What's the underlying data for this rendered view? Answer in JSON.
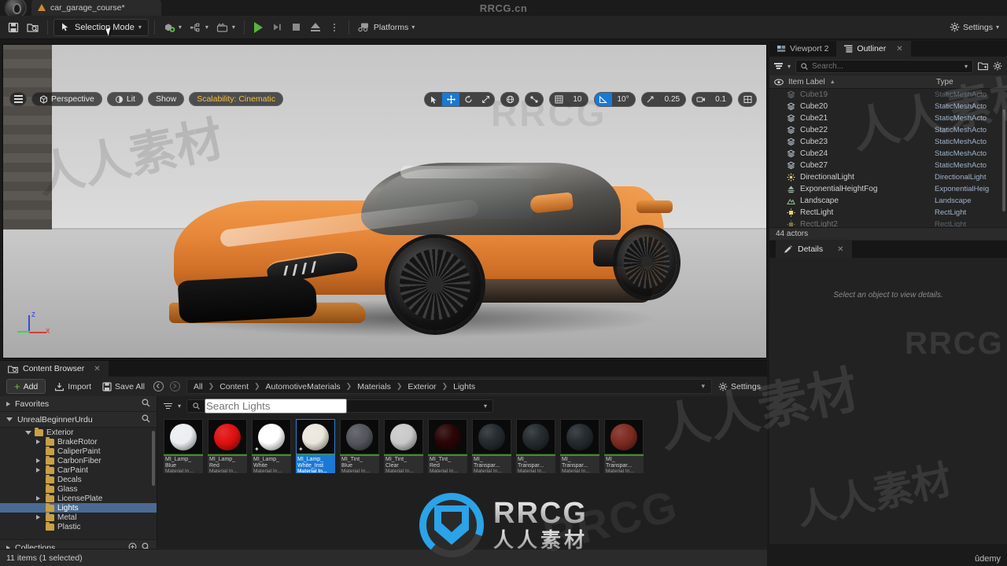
{
  "titlebar": {
    "project_tab": "car_garage_course*",
    "brand_watermark": "RRCG.cn"
  },
  "toolbar": {
    "save_label": "Save",
    "save_all_icon": "save-icon",
    "browse_icon": "browse-content-icon",
    "selection_mode": "Selection Mode",
    "quick_add": "quick-add-icon",
    "blueprints": "blueprints-icon",
    "cinematics": "cinematics-icon",
    "play": "play-icon",
    "skip": "skip-icon",
    "stop": "stop-icon",
    "eject": "eject-icon",
    "more": "more-options-icon",
    "platforms": "Platforms",
    "settings": "Settings"
  },
  "viewport": {
    "menu_icon": "viewport-menu-icon",
    "perspective": "Perspective",
    "lit": "Lit",
    "show": "Show",
    "scalability": "Scalability: Cinematic",
    "tools": {
      "select": "select-tool-icon",
      "translate": "translate-tool-icon",
      "rotate": "rotate-tool-icon",
      "scale": "scale-tool-icon",
      "world_coords": "world-coordinates-icon",
      "surface_snap": "surface-snap-icon",
      "grid_snap_icon": "grid-snap-icon",
      "grid_snap_value": "10",
      "angle_snap_icon": "angle-snap-icon",
      "angle_snap_value": "10°",
      "scale_snap_icon": "scale-snap-icon",
      "scale_snap_value": "0.25",
      "camera_speed_icon": "camera-speed-icon",
      "camera_speed_value": "0.1",
      "maximize_icon": "maximize-viewport-icon"
    },
    "axis": {
      "z": "Z",
      "x": "X"
    }
  },
  "outliner": {
    "tab_viewport": "Viewport 2",
    "tab_outliner": "Outliner",
    "search_placeholder": "Search...",
    "search_value": "",
    "col_item_label": "Item Label",
    "col_type": "Type",
    "sort_indicator": "▲",
    "rows": [
      {
        "name": "Cube19",
        "type": "StaticMeshActo",
        "icon": "static-mesh-icon"
      },
      {
        "name": "Cube20",
        "type": "StaticMeshActo",
        "icon": "static-mesh-icon"
      },
      {
        "name": "Cube21",
        "type": "StaticMeshActo",
        "icon": "static-mesh-icon"
      },
      {
        "name": "Cube22",
        "type": "StaticMeshActo",
        "icon": "static-mesh-icon"
      },
      {
        "name": "Cube23",
        "type": "StaticMeshActo",
        "icon": "static-mesh-icon"
      },
      {
        "name": "Cube24",
        "type": "StaticMeshActo",
        "icon": "static-mesh-icon"
      },
      {
        "name": "Cube27",
        "type": "StaticMeshActo",
        "icon": "static-mesh-icon"
      },
      {
        "name": "DirectionalLight",
        "type": "DirectionalLight",
        "icon": "directional-light-icon"
      },
      {
        "name": "ExponentialHeightFog",
        "type": "ExponentialHeig",
        "icon": "fog-icon"
      },
      {
        "name": "Landscape",
        "type": "Landscape",
        "icon": "landscape-icon"
      },
      {
        "name": "RectLight",
        "type": "RectLight",
        "icon": "rect-light-icon"
      },
      {
        "name": "RectLight2",
        "type": "RectLight",
        "icon": "rect-light-icon"
      }
    ],
    "footer": "44 actors"
  },
  "details": {
    "tab_label": "Details",
    "empty_message": "Select an object to view details."
  },
  "content_browser": {
    "tab_label": "Content Browser",
    "add_label": "Add",
    "import_label": "Import",
    "save_all_label": "Save All",
    "back_icon": "nav-back-icon",
    "forward_icon": "nav-forward-icon",
    "breadcrumbs": [
      "All",
      "Content",
      "AutomotiveMaterials",
      "Materials",
      "Exterior",
      "Lights"
    ],
    "settings_label": "Settings",
    "favorites_label": "Favorites",
    "project_root_label": "UnrealBeginnerUrdu",
    "collections_label": "Collections",
    "tree": [
      {
        "label": "Exterior",
        "depth": 1,
        "expanded": true,
        "selected": false,
        "has_children": true
      },
      {
        "label": "BrakeRotor",
        "depth": 2,
        "expanded": false,
        "selected": false,
        "has_children": true
      },
      {
        "label": "CaliperPaint",
        "depth": 2,
        "expanded": false,
        "selected": false,
        "has_children": false
      },
      {
        "label": "CarbonFiber",
        "depth": 2,
        "expanded": false,
        "selected": false,
        "has_children": true
      },
      {
        "label": "CarPaint",
        "depth": 2,
        "expanded": false,
        "selected": false,
        "has_children": true
      },
      {
        "label": "Decals",
        "depth": 2,
        "expanded": false,
        "selected": false,
        "has_children": false
      },
      {
        "label": "Glass",
        "depth": 2,
        "expanded": false,
        "selected": false,
        "has_children": false
      },
      {
        "label": "LicensePlate",
        "depth": 2,
        "expanded": false,
        "selected": false,
        "has_children": true
      },
      {
        "label": "Lights",
        "depth": 2,
        "expanded": false,
        "selected": true,
        "has_children": false
      },
      {
        "label": "Metal",
        "depth": 2,
        "expanded": false,
        "selected": false,
        "has_children": true
      },
      {
        "label": "Plastic",
        "depth": 2,
        "expanded": false,
        "selected": false,
        "has_children": false
      }
    ],
    "asset_search_placeholder": "Search Lights",
    "assets": [
      {
        "name": "MI_Lamp_",
        "name2": "Blue",
        "type": "Material In...",
        "color": "#eceff2",
        "selected": false,
        "starred": false
      },
      {
        "name": "MI_Lamp_",
        "name2": "Red",
        "type": "Material In...",
        "color": "#e01111",
        "selected": false,
        "starred": false
      },
      {
        "name": "MI_Lamp_",
        "name2": "White",
        "type": "Material In...",
        "color": "#ffffff",
        "selected": false,
        "starred": true
      },
      {
        "name": "MI_Lamp_",
        "name2": "White_Inst",
        "type": "Material In...",
        "color": "#ece7dd",
        "selected": true,
        "starred": true
      },
      {
        "name": "MI_Tint_",
        "name2": "Blue",
        "type": "Material In...",
        "color": "#53565c",
        "selected": false,
        "starred": false
      },
      {
        "name": "MI_Tint_",
        "name2": "Clear",
        "type": "Material In...",
        "color": "#c9c9c9",
        "selected": false,
        "starred": false
      },
      {
        "name": "MI_Tint_",
        "name2": "Red",
        "type": "Material In...",
        "color": "#2a0506",
        "selected": false,
        "starred": false
      },
      {
        "name": "MI_",
        "name2": "Transpar...",
        "type": "Material In...",
        "color": "#242a2e",
        "selected": false,
        "starred": false
      },
      {
        "name": "MI_",
        "name2": "Transpar...",
        "type": "Material In...",
        "color": "#242a2e",
        "selected": false,
        "starred": false
      },
      {
        "name": "MI_",
        "name2": "Transpar...",
        "type": "Material In...",
        "color": "#242a2e",
        "selected": false,
        "starred": false
      },
      {
        "name": "MI_",
        "name2": "Transpar...",
        "type": "Material In...",
        "color": "#7e2b22",
        "selected": false,
        "starred": false
      }
    ],
    "status": "11 items (1 selected)"
  },
  "branding": {
    "logo_text": "RRCG",
    "logo_cn": "人人素材",
    "udemy": "ûdemy"
  },
  "watermarks": {
    "cn_text": "人人素材",
    "rrcg": "RRCG"
  },
  "colors": {
    "accent_blue": "#1a79d4",
    "green": "#6fbf4a",
    "orange_car": "#e8883a",
    "scalability": "#f0c040"
  }
}
